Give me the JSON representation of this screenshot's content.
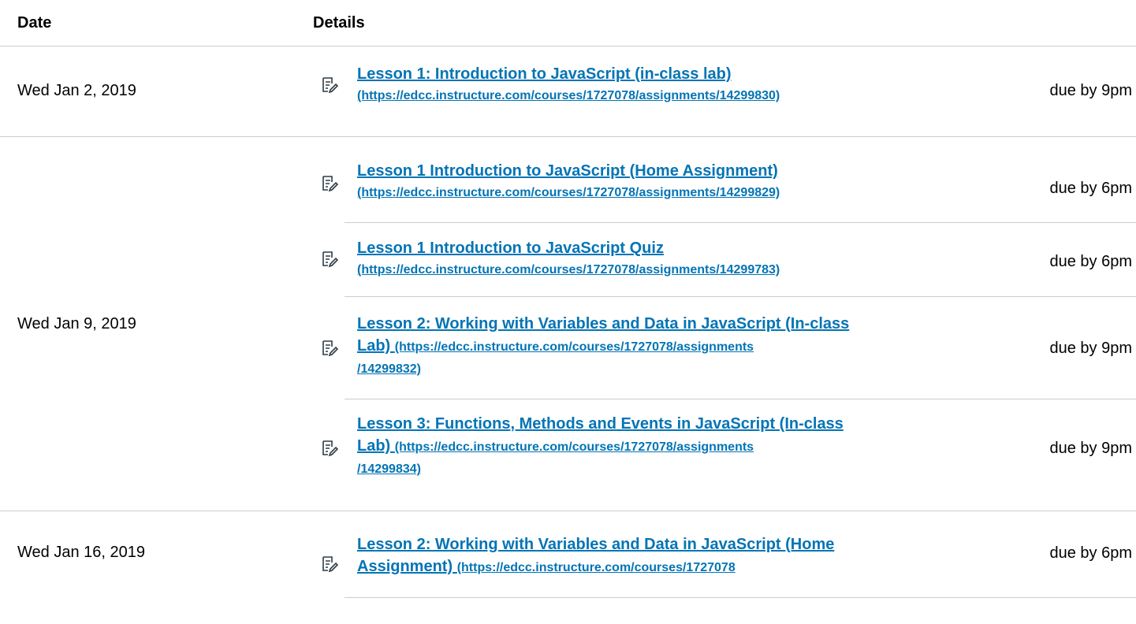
{
  "headers": {
    "date": "Date",
    "details": "Details"
  },
  "rows": [
    {
      "date": "Wed Jan 2, 2019",
      "items": [
        {
          "title_lines": [
            "Lesson 1: Introduction to JavaScript (in-class lab)",
            ""
          ],
          "url_lines": [
            "",
            "(https://edcc.instructure.com/courses/1727078/assignments/14299830)"
          ],
          "due": "due by 9pm"
        }
      ]
    },
    {
      "date": "Wed Jan 9, 2019",
      "items": [
        {
          "title_lines": [
            "Lesson 1 Introduction to JavaScript (Home Assignment)",
            ""
          ],
          "url_lines": [
            "",
            "(https://edcc.instructure.com/courses/1727078/assignments/14299829)"
          ],
          "due": "due by 6pm"
        },
        {
          "title_lines": [
            "Lesson 1 Introduction to JavaScript Quiz",
            ""
          ],
          "url_lines": [
            "",
            "(https://edcc.instructure.com/courses/1727078/assignments/14299783)"
          ],
          "due": "due by 6pm"
        },
        {
          "title_lines": [
            "Lesson 2: Working with Variables and Data in JavaScript (In-class",
            "Lab) "
          ],
          "url_lines": [
            "",
            "(https://edcc.instructure.com/courses/1727078/assignments",
            "/14299832)"
          ],
          "due": "due by 9pm"
        },
        {
          "title_lines": [
            "Lesson 3: Functions, Methods and Events in JavaScript (In-class",
            "Lab) "
          ],
          "url_lines": [
            "",
            "(https://edcc.instructure.com/courses/1727078/assignments",
            "/14299834)"
          ],
          "due": "due by 9pm"
        }
      ]
    },
    {
      "date": "Wed Jan 16, 2019",
      "items": [
        {
          "title_lines": [
            "Lesson 2: Working with Variables and Data in JavaScript (Home",
            "Assignment) "
          ],
          "url_lines": [
            "",
            "(https://edcc.instructure.com/courses/1727078"
          ],
          "due": "due by 6pm"
        }
      ]
    }
  ]
}
